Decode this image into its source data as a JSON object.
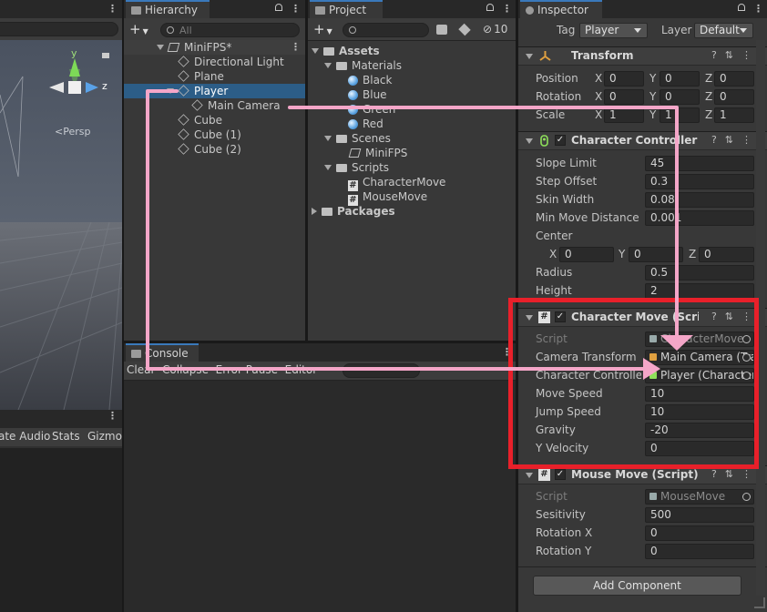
{
  "scene": {
    "persp_label": "<Persp",
    "gizmo_y": "y",
    "gizmo_z": "z",
    "bottom_bar": {
      "audio": "ate Audio",
      "stats": "Stats",
      "gizmos": "Gizmo"
    }
  },
  "hierarchy": {
    "tab": "Hierarchy",
    "search_placeholder": "All",
    "scene_name": "MiniFPS*",
    "items": [
      {
        "label": "Directional Light"
      },
      {
        "label": "Plane"
      },
      {
        "label": "Player"
      },
      {
        "label": "Main Camera"
      },
      {
        "label": "Cube"
      },
      {
        "label": "Cube (1)"
      },
      {
        "label": "Cube (2)"
      }
    ]
  },
  "project": {
    "tab": "Project",
    "hidden_count": "10",
    "assets": "Assets",
    "materials": "Materials",
    "mats": [
      "Black",
      "Blue",
      "Green",
      "Red"
    ],
    "scenes": "Scenes",
    "scene_file": "MiniFPS",
    "scripts": "Scripts",
    "script_files": [
      "CharacterMove",
      "MouseMove"
    ],
    "packages": "Packages"
  },
  "console": {
    "tab": "Console",
    "toolbar": "Clear  Collapse  Error Pause  Editor"
  },
  "inspector": {
    "tab": "Inspector",
    "tag_label": "Tag",
    "tag_value": "Player",
    "layer_label": "Layer",
    "layer_value": "Default",
    "transform": {
      "title": "Transform",
      "position_label": "Position",
      "rotation_label": "Rotation",
      "scale_label": "Scale",
      "position": [
        "0",
        "0",
        "0"
      ],
      "rotation": [
        "0",
        "0",
        "0"
      ],
      "scale": [
        "1",
        "1",
        "1"
      ]
    },
    "cc": {
      "title": "Character Controller",
      "slope_limit": {
        "label": "Slope Limit",
        "value": "45"
      },
      "step_offset": {
        "label": "Step Offset",
        "value": "0.3"
      },
      "skin_width": {
        "label": "Skin Width",
        "value": "0.08"
      },
      "min_move": {
        "label": "Min Move Distance",
        "value": "0.001"
      },
      "center_label": "Center",
      "center": [
        "0",
        "0",
        "0"
      ],
      "radius": {
        "label": "Radius",
        "value": "0.5"
      },
      "height": {
        "label": "Height",
        "value": "2"
      }
    },
    "cm": {
      "title": "Character Move (Script)",
      "script": {
        "label": "Script",
        "value": "CharacterMove"
      },
      "camera_transform": {
        "label": "Camera Transform",
        "value": "Main Camera (Transform)"
      },
      "character_controller": {
        "label": "Character Controller",
        "value": "Player (Character Controller)"
      },
      "move_speed": {
        "label": "Move Speed",
        "value": "10"
      },
      "jump_speed": {
        "label": "Jump Speed",
        "value": "10"
      },
      "gravity": {
        "label": "Gravity",
        "value": "-20"
      },
      "y_velocity": {
        "label": "Y Velocity",
        "value": "0"
      }
    },
    "mm": {
      "title": "Mouse Move (Script)",
      "script": {
        "label": "Script",
        "value": "MouseMove"
      },
      "sensitivity": {
        "label": "Sesitivity",
        "value": "500"
      },
      "rotation_x": {
        "label": "Rotation X",
        "value": "0"
      },
      "rotation_y": {
        "label": "Rotation Y",
        "value": "0"
      }
    },
    "add_component": "Add Component",
    "axis": {
      "x": "X",
      "y": "Y",
      "z": "Z"
    }
  },
  "colors": {
    "selection": "#2c5d87",
    "highlight_box": "#e8202a",
    "annotation_arrow": "#f4a6c8"
  }
}
